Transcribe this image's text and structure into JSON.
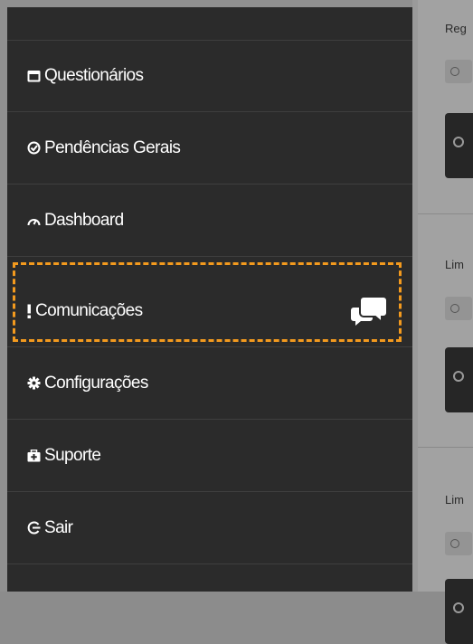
{
  "sidebar": {
    "items": [
      {
        "label": "Questionários",
        "icon": "clipboard-icon"
      },
      {
        "label": "Pendências Gerais",
        "icon": "check-circle-icon"
      },
      {
        "label": "Dashboard",
        "icon": "gauge-icon"
      },
      {
        "label": "Comunicações",
        "icon": "exclamation-icon"
      },
      {
        "label": "Configurações",
        "icon": "gear-icon"
      },
      {
        "label": "Suporte",
        "icon": "briefcase-medical-icon"
      },
      {
        "label": "Sair",
        "icon": "sign-out-icon"
      }
    ],
    "highlight_color": "#f39a1e",
    "background": "#2b2b2b"
  },
  "content": {
    "labels": [
      "Reg",
      "Lim",
      "Lim"
    ]
  }
}
